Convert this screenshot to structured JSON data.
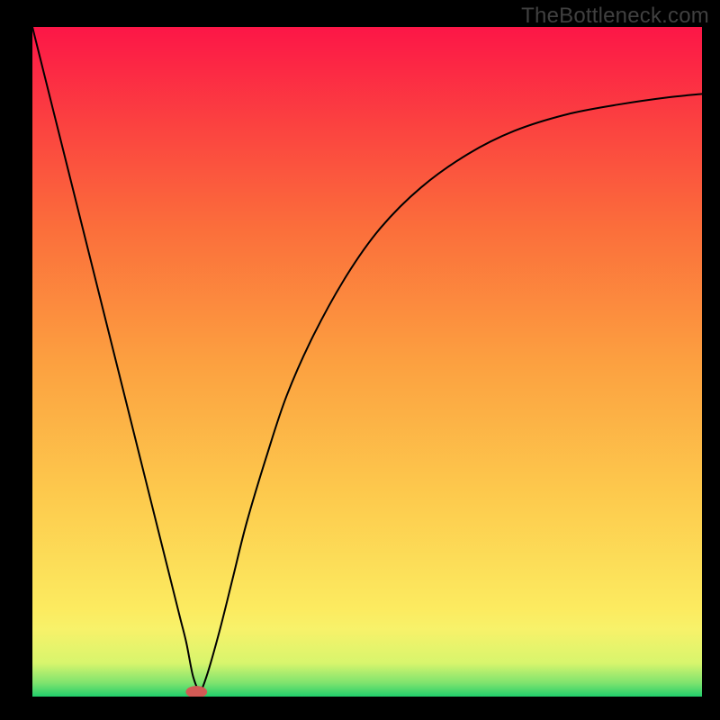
{
  "watermark": "TheBottleneck.com",
  "chart_data": {
    "type": "line",
    "title": "",
    "xlabel": "",
    "ylabel": "",
    "xlim": [
      0,
      100
    ],
    "ylim": [
      0,
      100
    ],
    "background_gradient_stops": [
      {
        "offset": 0.0,
        "color": "#21ce6b"
      },
      {
        "offset": 0.02,
        "color": "#7de36e"
      },
      {
        "offset": 0.05,
        "color": "#d8f56d"
      },
      {
        "offset": 0.1,
        "color": "#f7f26a"
      },
      {
        "offset": 0.13,
        "color": "#fceb60"
      },
      {
        "offset": 0.3,
        "color": "#fdca4d"
      },
      {
        "offset": 0.5,
        "color": "#fca040"
      },
      {
        "offset": 0.7,
        "color": "#fb6e3b"
      },
      {
        "offset": 0.85,
        "color": "#fb4340"
      },
      {
        "offset": 1.0,
        "color": "#fc1647"
      }
    ],
    "series": [
      {
        "name": "bottleneck-curve",
        "color": "#000000",
        "x": [
          0,
          5,
          10,
          15,
          20,
          22,
          23,
          24,
          25,
          26,
          28,
          30,
          32,
          35,
          38,
          42,
          47,
          52,
          58,
          65,
          72,
          80,
          88,
          95,
          100
        ],
        "values": [
          100,
          80,
          60,
          40,
          20,
          12,
          8,
          3,
          1,
          3,
          10,
          18,
          26,
          36,
          45,
          54,
          63,
          70,
          76,
          81,
          84.5,
          87,
          88.5,
          89.5,
          90
        ]
      }
    ],
    "marker": {
      "name": "optimal-point",
      "x": 24.5,
      "y": 0.7,
      "rx": 1.6,
      "ry": 0.9,
      "color": "#d35a55"
    }
  }
}
